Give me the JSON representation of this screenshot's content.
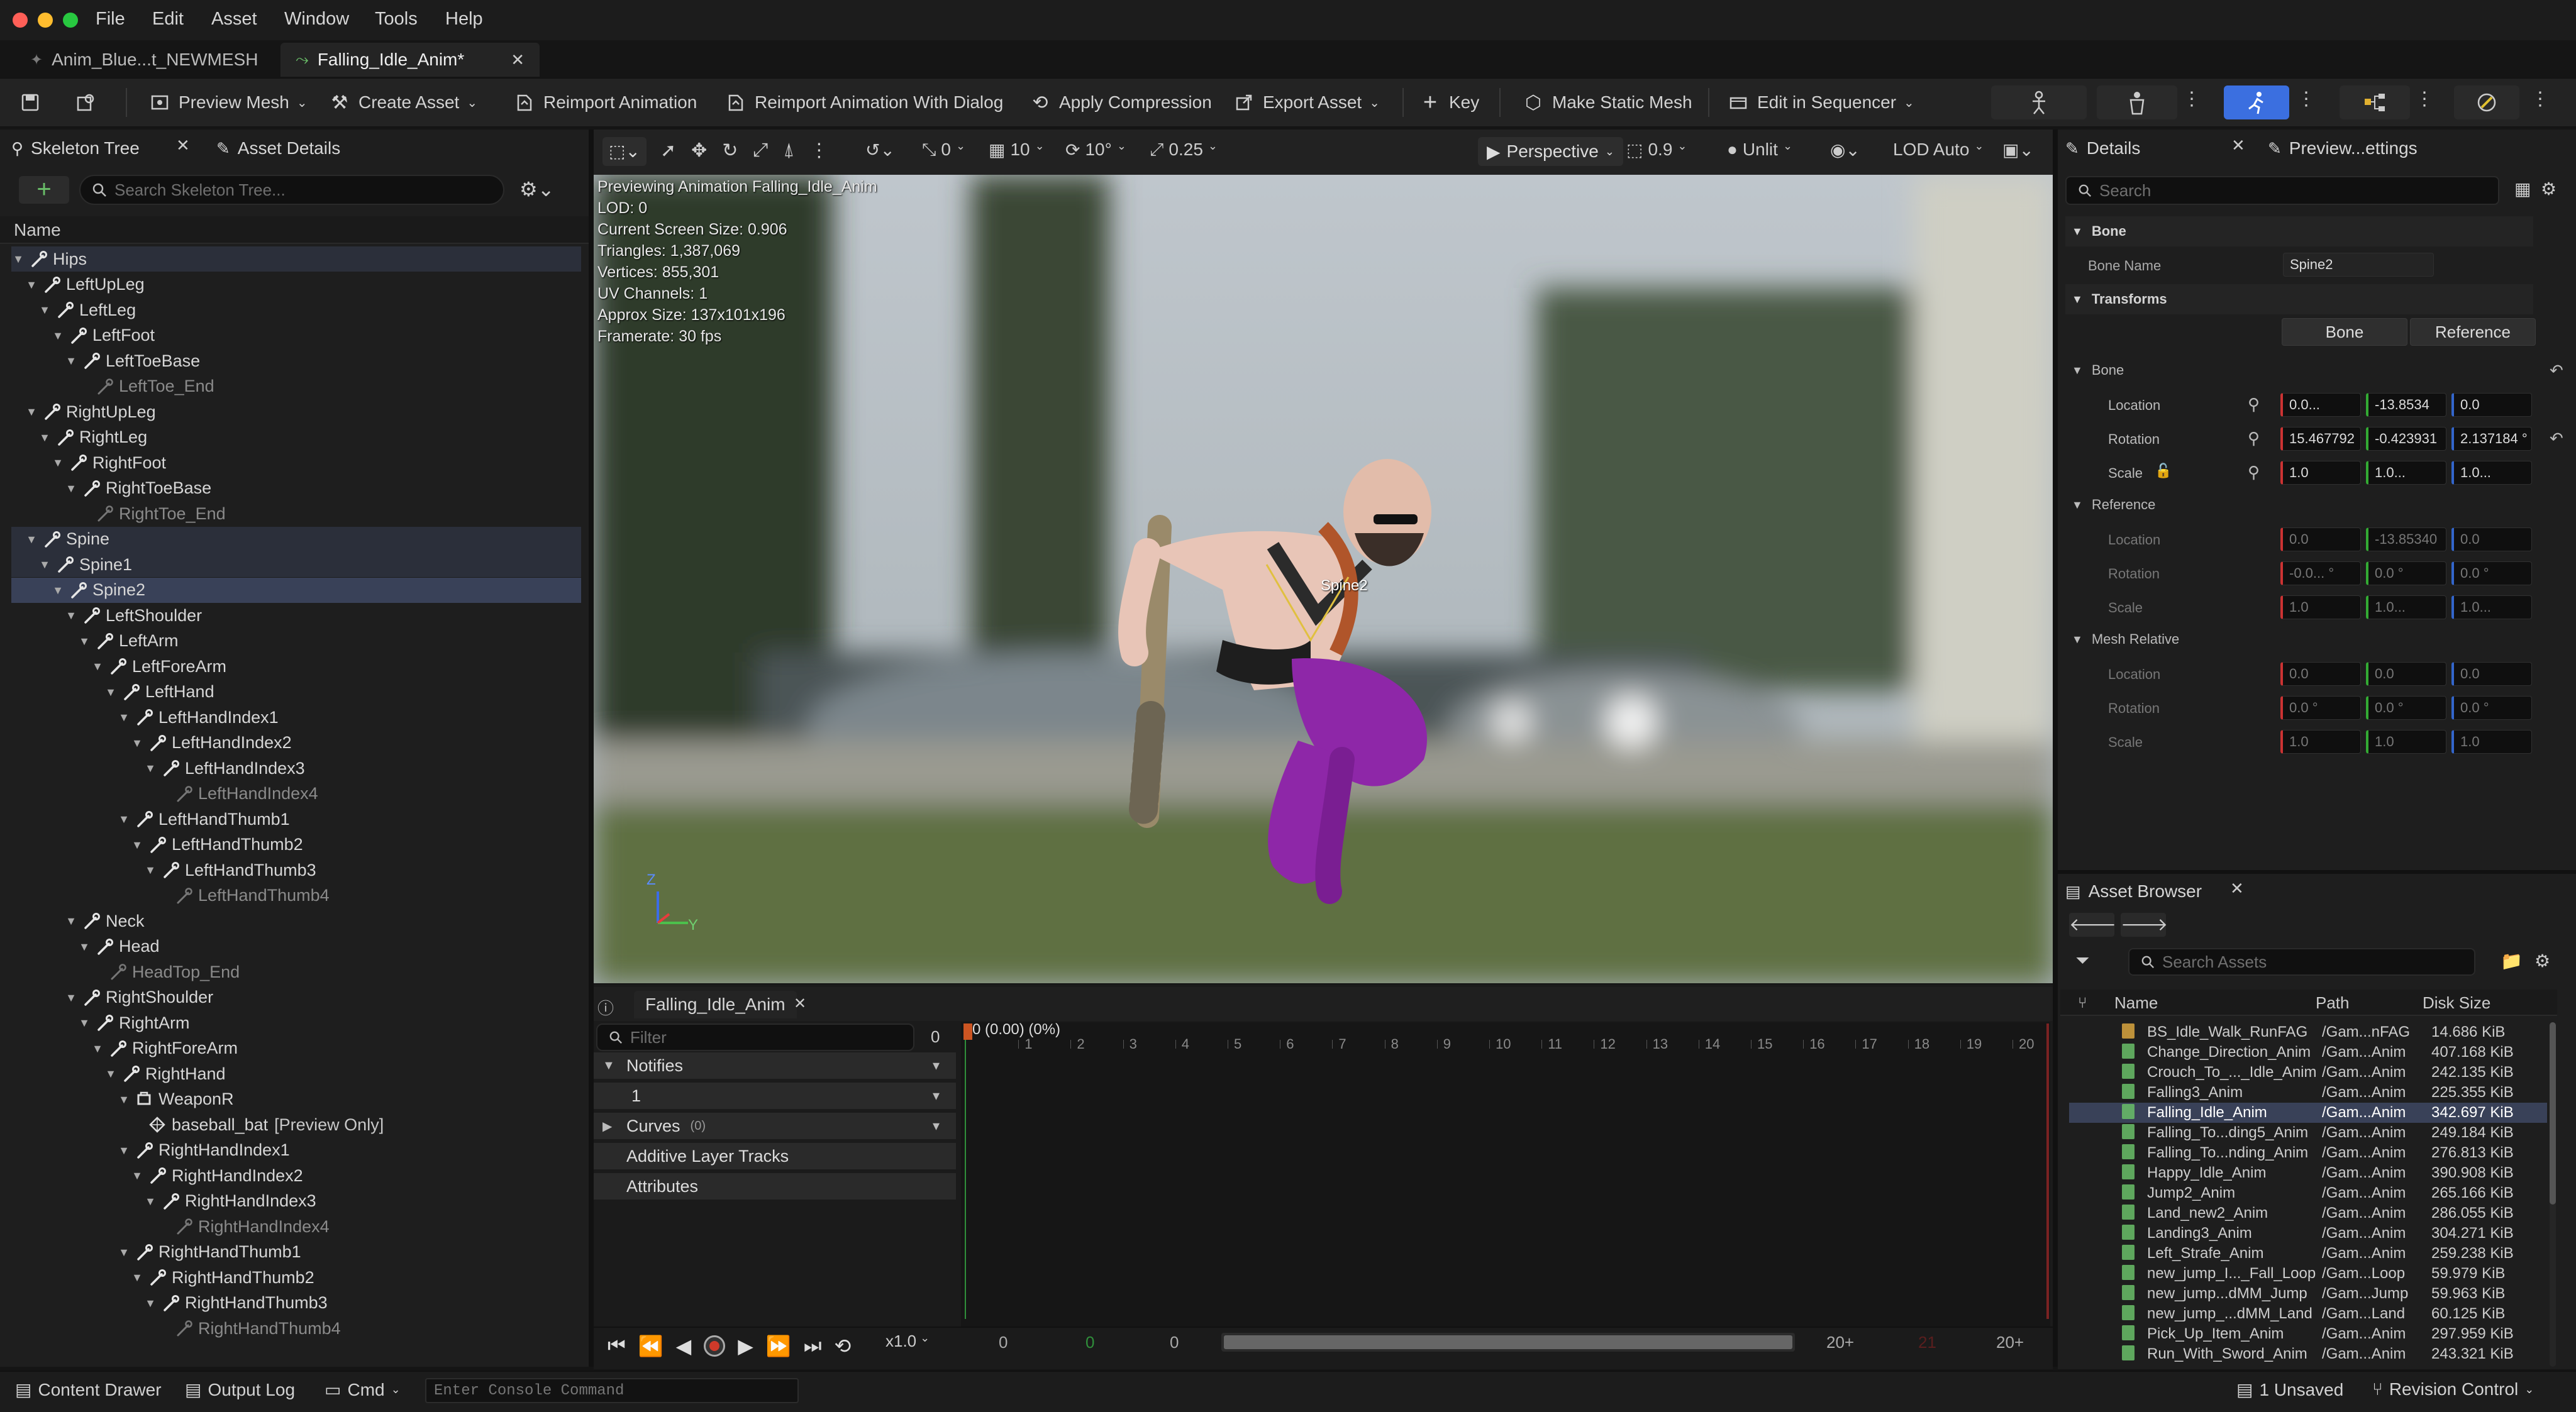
{
  "menu": [
    "File",
    "Edit",
    "Asset",
    "Window",
    "Tools",
    "Help"
  ],
  "doc_tabs": [
    {
      "label": "Anim_Blue...t_NEWMESH",
      "active": false
    },
    {
      "label": "Falling_Idle_Anim*",
      "active": true
    }
  ],
  "toolbar": {
    "preview_mesh": "Preview Mesh",
    "create_asset": "Create Asset",
    "reimport": "Reimport Animation",
    "reimport_dialog": "Reimport Animation With Dialog",
    "apply_compression": "Apply Compression",
    "export_asset": "Export Asset",
    "key": "Key",
    "make_static_mesh": "Make Static Mesh",
    "edit_in_sequencer": "Edit in Sequencer"
  },
  "left_panel": {
    "tab_skeleton": "Skeleton Tree",
    "tab_asset_details": "Asset Details",
    "search_placeholder": "Search Skeleton Tree...",
    "column_name": "Name",
    "tree": [
      {
        "label": "Hips",
        "d": 0,
        "type": "bone",
        "state": "hl",
        "arrow": true
      },
      {
        "label": "LeftUpLeg",
        "d": 1,
        "type": "bone",
        "arrow": true
      },
      {
        "label": "LeftLeg",
        "d": 2,
        "type": "bone",
        "arrow": true
      },
      {
        "label": "LeftFoot",
        "d": 3,
        "type": "bone",
        "arrow": true
      },
      {
        "label": "LeftToeBase",
        "d": 4,
        "type": "bone",
        "arrow": true
      },
      {
        "label": "LeftToe_End",
        "d": 5,
        "type": "dim"
      },
      {
        "label": "RightUpLeg",
        "d": 1,
        "type": "bone",
        "arrow": true
      },
      {
        "label": "RightLeg",
        "d": 2,
        "type": "bone",
        "arrow": true
      },
      {
        "label": "RightFoot",
        "d": 3,
        "type": "bone",
        "arrow": true
      },
      {
        "label": "RightToeBase",
        "d": 4,
        "type": "bone",
        "arrow": true
      },
      {
        "label": "RightToe_End",
        "d": 5,
        "type": "dim"
      },
      {
        "label": "Spine",
        "d": 1,
        "type": "bone",
        "state": "hl",
        "arrow": true
      },
      {
        "label": "Spine1",
        "d": 2,
        "type": "bone",
        "state": "hl",
        "arrow": true
      },
      {
        "label": "Spine2",
        "d": 3,
        "type": "bone",
        "state": "sel",
        "arrow": true
      },
      {
        "label": "LeftShoulder",
        "d": 4,
        "type": "bone",
        "arrow": true
      },
      {
        "label": "LeftArm",
        "d": 5,
        "type": "bone",
        "arrow": true
      },
      {
        "label": "LeftForeArm",
        "d": 6,
        "type": "bone",
        "arrow": true
      },
      {
        "label": "LeftHand",
        "d": 7,
        "type": "bone",
        "arrow": true
      },
      {
        "label": "LeftHandIndex1",
        "d": 8,
        "type": "bone",
        "arrow": true
      },
      {
        "label": "LeftHandIndex2",
        "d": 9,
        "type": "bone",
        "arrow": true
      },
      {
        "label": "LeftHandIndex3",
        "d": 10,
        "type": "bone",
        "arrow": true
      },
      {
        "label": "LeftHandIndex4",
        "d": 11,
        "type": "dim"
      },
      {
        "label": "LeftHandThumb1",
        "d": 8,
        "type": "bone",
        "arrow": true
      },
      {
        "label": "LeftHandThumb2",
        "d": 9,
        "type": "bone",
        "arrow": true
      },
      {
        "label": "LeftHandThumb3",
        "d": 10,
        "type": "bone",
        "arrow": true
      },
      {
        "label": "LeftHandThumb4",
        "d": 11,
        "type": "dim"
      },
      {
        "label": "Neck",
        "d": 4,
        "type": "bone",
        "arrow": true
      },
      {
        "label": "Head",
        "d": 5,
        "type": "bone",
        "arrow": true
      },
      {
        "label": "HeadTop_End",
        "d": 6,
        "type": "dim"
      },
      {
        "label": "RightShoulder",
        "d": 4,
        "type": "bone",
        "arrow": true
      },
      {
        "label": "RightArm",
        "d": 5,
        "type": "bone",
        "arrow": true
      },
      {
        "label": "RightForeArm",
        "d": 6,
        "type": "bone",
        "arrow": true
      },
      {
        "label": "RightHand",
        "d": 7,
        "type": "bone",
        "arrow": true
      },
      {
        "label": "WeaponR",
        "d": 8,
        "type": "socket",
        "arrow": true
      },
      {
        "label": "baseball_bat",
        "suffix": "[Preview Only]",
        "d": 9,
        "type": "mesh"
      },
      {
        "label": "RightHandIndex1",
        "d": 8,
        "type": "bone",
        "arrow": true
      },
      {
        "label": "RightHandIndex2",
        "d": 9,
        "type": "bone",
        "arrow": true
      },
      {
        "label": "RightHandIndex3",
        "d": 10,
        "type": "bone",
        "arrow": true
      },
      {
        "label": "RightHandIndex4",
        "d": 11,
        "type": "dim"
      },
      {
        "label": "RightHandThumb1",
        "d": 8,
        "type": "bone",
        "arrow": true
      },
      {
        "label": "RightHandThumb2",
        "d": 9,
        "type": "bone",
        "arrow": true
      },
      {
        "label": "RightHandThumb3",
        "d": 10,
        "type": "bone",
        "arrow": true
      },
      {
        "label": "RightHandThumb4",
        "d": 11,
        "type": "dim"
      }
    ]
  },
  "viewport": {
    "toolbar": {
      "rot_snap": "0",
      "grid_snap": "10",
      "angle_snap": "10°",
      "scale_snap": "0.25",
      "view_mode": "Perspective",
      "fov": "0.9",
      "lighting": "Unlit",
      "lod": "LOD Auto"
    },
    "info": [
      "Previewing Animation Falling_Idle_Anim",
      "LOD: 0",
      "Current Screen Size: 0.906",
      "Triangles: 1,387,069",
      "Vertices: 855,301",
      "UV Channels: 1",
      "Approx Size: 137x101x196",
      "Framerate: 30 fps"
    ],
    "bone_label": "Spine2",
    "axis_z": "Z",
    "axis_y": "Y"
  },
  "sequencer": {
    "tab": "Falling_Idle_Anim",
    "filter_placeholder": "Filter",
    "filter_count": "0",
    "current_frame": "0 (0.00) (0%)",
    "tracks": {
      "notifies": "Notifies",
      "notify_1": "1",
      "curves": "Curves",
      "curves_count": "(0)",
      "additive": "Additive Layer Tracks",
      "attributes": "Attributes"
    },
    "ruler": [
      "0",
      "1",
      "2",
      "3",
      "4",
      "5",
      "6",
      "7",
      "8",
      "9",
      "10",
      "11",
      "12",
      "13",
      "14",
      "15",
      "16",
      "17",
      "18",
      "19",
      "20"
    ],
    "speed": "x1.0",
    "range_start": "0",
    "range_green": "0",
    "range_cur": "0",
    "range_end": "20+",
    "range_red": "21",
    "range_end2": "20+"
  },
  "details": {
    "tab": "Details",
    "tab2": "Preview...ettings",
    "search_placeholder": "Search",
    "bone_header": "Bone",
    "bone_name_label": "Bone Name",
    "bone_name_value": "Spine2",
    "transforms_header": "Transforms",
    "btn_bone": "Bone",
    "btn_reference": "Reference",
    "sections": [
      {
        "title": "Bone",
        "rows": [
          {
            "label": "Location",
            "v": [
              "0.0...",
              "-13.8534",
              "0.0"
            ],
            "bright": true
          },
          {
            "label": "Rotation",
            "v": [
              "15.467792",
              "-0.423931",
              "2.137184 °"
            ],
            "bright": true
          },
          {
            "label": "Scale",
            "v": [
              "1.0",
              "1.0...",
              "1.0..."
            ],
            "bright": true
          }
        ]
      },
      {
        "title": "Reference",
        "rows": [
          {
            "label": "Location",
            "v": [
              "0.0",
              "-13.85340",
              "0.0"
            ]
          },
          {
            "label": "Rotation",
            "v": [
              "-0.0... °",
              "0.0 °",
              "0.0 °"
            ]
          },
          {
            "label": "Scale",
            "v": [
              "1.0",
              "1.0...",
              "1.0..."
            ]
          }
        ]
      },
      {
        "title": "Mesh Relative",
        "rows": [
          {
            "label": "Location",
            "v": [
              "0.0",
              "0.0",
              "0.0"
            ]
          },
          {
            "label": "Rotation",
            "v": [
              "0.0 °",
              "0.0 °",
              "0.0 °"
            ]
          },
          {
            "label": "Scale",
            "v": [
              "1.0",
              "1.0",
              "1.0"
            ]
          }
        ]
      }
    ]
  },
  "asset_browser": {
    "tab": "Asset Browser",
    "search_placeholder": "Search Assets",
    "columns": {
      "name": "Name",
      "path": "Path",
      "size": "Disk Size"
    },
    "rows": [
      {
        "name": "BS_Idle_Walk_RunFAG",
        "path": "/Gam...nFAG",
        "size": "14.686 KiB",
        "kind": "bs"
      },
      {
        "name": "Change_Direction_Anim",
        "path": "/Gam...Anim",
        "size": "407.168 KiB"
      },
      {
        "name": "Crouch_To_..._Idle_Anim",
        "path": "/Gam...Anim",
        "size": "242.135 KiB"
      },
      {
        "name": "Falling3_Anim",
        "path": "/Gam...Anim",
        "size": "225.355 KiB"
      },
      {
        "name": "Falling_Idle_Anim",
        "path": "/Gam...Anim",
        "size": "342.697 KiB",
        "sel": true
      },
      {
        "name": "Falling_To...ding5_Anim",
        "path": "/Gam...Anim",
        "size": "249.184 KiB"
      },
      {
        "name": "Falling_To...nding_Anim",
        "path": "/Gam...Anim",
        "size": "276.813 KiB"
      },
      {
        "name": "Happy_Idle_Anim",
        "path": "/Gam...Anim",
        "size": "390.908 KiB"
      },
      {
        "name": "Jump2_Anim",
        "path": "/Gam...Anim",
        "size": "265.166 KiB"
      },
      {
        "name": "Land_new2_Anim",
        "path": "/Gam...Anim",
        "size": "286.055 KiB"
      },
      {
        "name": "Landing3_Anim",
        "path": "/Gam...Anim",
        "size": "304.271 KiB"
      },
      {
        "name": "Left_Strafe_Anim",
        "path": "/Gam...Anim",
        "size": "259.238 KiB"
      },
      {
        "name": "new_jump_I..._Fall_Loop",
        "path": "/Gam...Loop",
        "size": "59.979 KiB"
      },
      {
        "name": "new_jump...dMM_Jump",
        "path": "/Gam...Jump",
        "size": "59.963 KiB"
      },
      {
        "name": "new_jump_...dMM_Land",
        "path": "/Gam...Land",
        "size": "60.125 KiB"
      },
      {
        "name": "Pick_Up_Item_Anim",
        "path": "/Gam...Anim",
        "size": "297.959 KiB"
      },
      {
        "name": "Run_With_Sword_Anim",
        "path": "/Gam...Anim",
        "size": "243.321 KiB"
      }
    ]
  },
  "statusbar": {
    "content_drawer": "Content Drawer",
    "output_log": "Output Log",
    "cmd": "Cmd",
    "console_placeholder": "Enter Console Command",
    "unsaved": "1 Unsaved",
    "revision": "Revision Control"
  },
  "colors": {
    "accent": "#3b6fe0",
    "selection": "#394158",
    "background": "#151515",
    "panel": "#1e1e1e",
    "bat_purple": "#8e27a8",
    "timeline_marker": "#cc5522"
  }
}
